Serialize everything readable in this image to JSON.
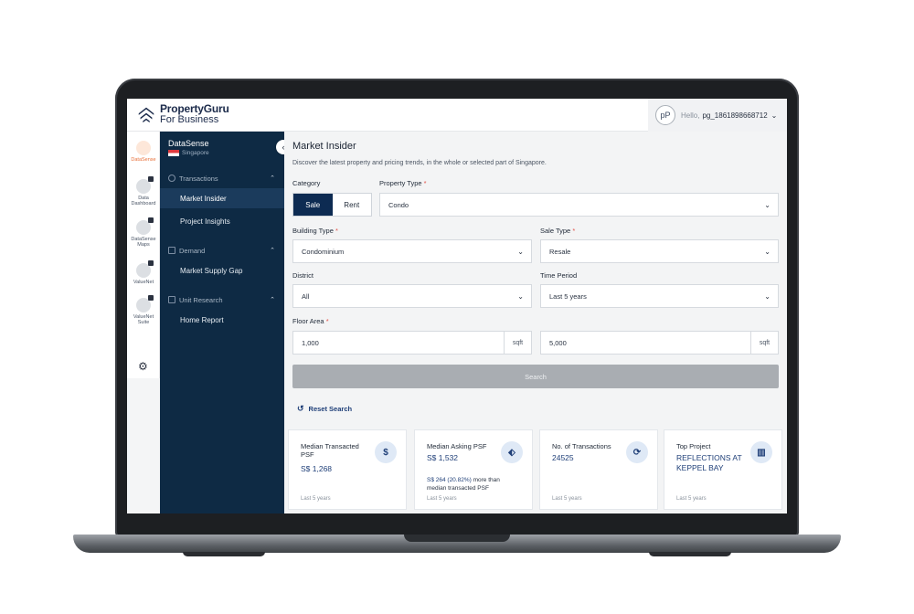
{
  "brand": {
    "line1": "PropertyGuru",
    "line2": "For Business"
  },
  "user": {
    "initials": "pP",
    "greeting": "Hello,",
    "name": "pg_1861898668712"
  },
  "rail": {
    "items": [
      {
        "label": "DataSense",
        "icon": "datasense-icon"
      },
      {
        "label": "Data Dashboard",
        "icon": "dashboard-icon"
      },
      {
        "label": "DataSense Maps",
        "icon": "maps-icon"
      },
      {
        "label": "ValueNet",
        "icon": "valuenet-icon"
      },
      {
        "label": "ValueNet Suite",
        "icon": "valuenet-suite-icon"
      }
    ]
  },
  "sidebar": {
    "title": "DataSense",
    "country": "Singapore",
    "sections": [
      {
        "label": "Transactions",
        "items": [
          "Market Insider",
          "Project Insights"
        ]
      },
      {
        "label": "Demand",
        "items": [
          "Market Supply Gap"
        ]
      },
      {
        "label": "Unit Research",
        "items": [
          "Home Report"
        ]
      }
    ]
  },
  "main": {
    "title": "Market Insider",
    "description": "Discover the latest property and pricing trends, in the whole or selected part of Singapore.",
    "category_label": "Category",
    "category_options": [
      "Sale",
      "Rent"
    ],
    "property_type_label": "Property Type",
    "property_type_value": "Condo",
    "building_type_label": "Building Type",
    "building_type_value": "Condominium",
    "sale_type_label": "Sale Type",
    "sale_type_value": "Resale",
    "district_label": "District",
    "district_value": "All",
    "time_period_label": "Time Period",
    "time_period_value": "Last 5 years",
    "floor_area_label": "Floor Area",
    "floor_min": "1,000",
    "floor_max": "5,000",
    "unit": "sqft",
    "required_mark": "*",
    "search_label": "Search",
    "reset_label": "Reset Search"
  },
  "cards": [
    {
      "title": "Median Transacted PSF",
      "value": "S$ 1,268",
      "note_value": "",
      "note_text": "",
      "footer": "Last 5 years",
      "icon": "dollar-cycle-icon"
    },
    {
      "title": "Median Asking PSF",
      "value": "S$ 1,532",
      "note_value": "S$ 264 (20.82%)",
      "note_text": " more than median transacted PSF",
      "footer": "Last 5 years",
      "icon": "price-tag-icon"
    },
    {
      "title": "No. of Transactions",
      "value": "24525",
      "note_value": "",
      "note_text": "",
      "footer": "Last 5 years",
      "icon": "transactions-icon"
    },
    {
      "title": "Top Project",
      "value": "REFLECTIONS AT KEPPEL BAY",
      "note_value": "",
      "note_text": "",
      "footer": "Last 5 years",
      "icon": "buildings-icon"
    }
  ],
  "colors": {
    "sidebar": "#0e2a44",
    "accent": "#0d2b52",
    "link": "#1f3f78",
    "rail_active": "#e8703a"
  }
}
